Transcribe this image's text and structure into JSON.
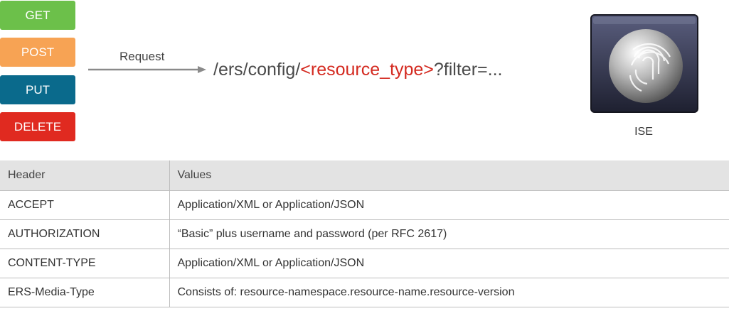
{
  "methods": {
    "get": {
      "label": "GET",
      "color": "#6cc04a"
    },
    "post": {
      "label": "POST",
      "color": "#f7a354"
    },
    "put": {
      "label": "PUT",
      "color": "#0a6a8c"
    },
    "delete": {
      "label": "DELETE",
      "color": "#e02a20"
    }
  },
  "request": {
    "arrow_label": "Request",
    "url_prefix": "/ers/config/",
    "url_resource": "<resource_type>",
    "url_suffix": "?filter=..."
  },
  "server": {
    "label": "ISE",
    "icon": "fingerprint-sphere-icon"
  },
  "table": {
    "headers": [
      "Header",
      "Values"
    ],
    "rows": [
      [
        "ACCEPT",
        "Application/XML or Application/JSON"
      ],
      [
        "AUTHORIZATION",
        "“Basic” plus username and password (per RFC 2617)"
      ],
      [
        "CONTENT-TYPE",
        "Application/XML or Application/JSON"
      ],
      [
        "ERS-Media-Type",
        "Consists of: resource-namespace.resource-name.resource-version"
      ]
    ]
  }
}
